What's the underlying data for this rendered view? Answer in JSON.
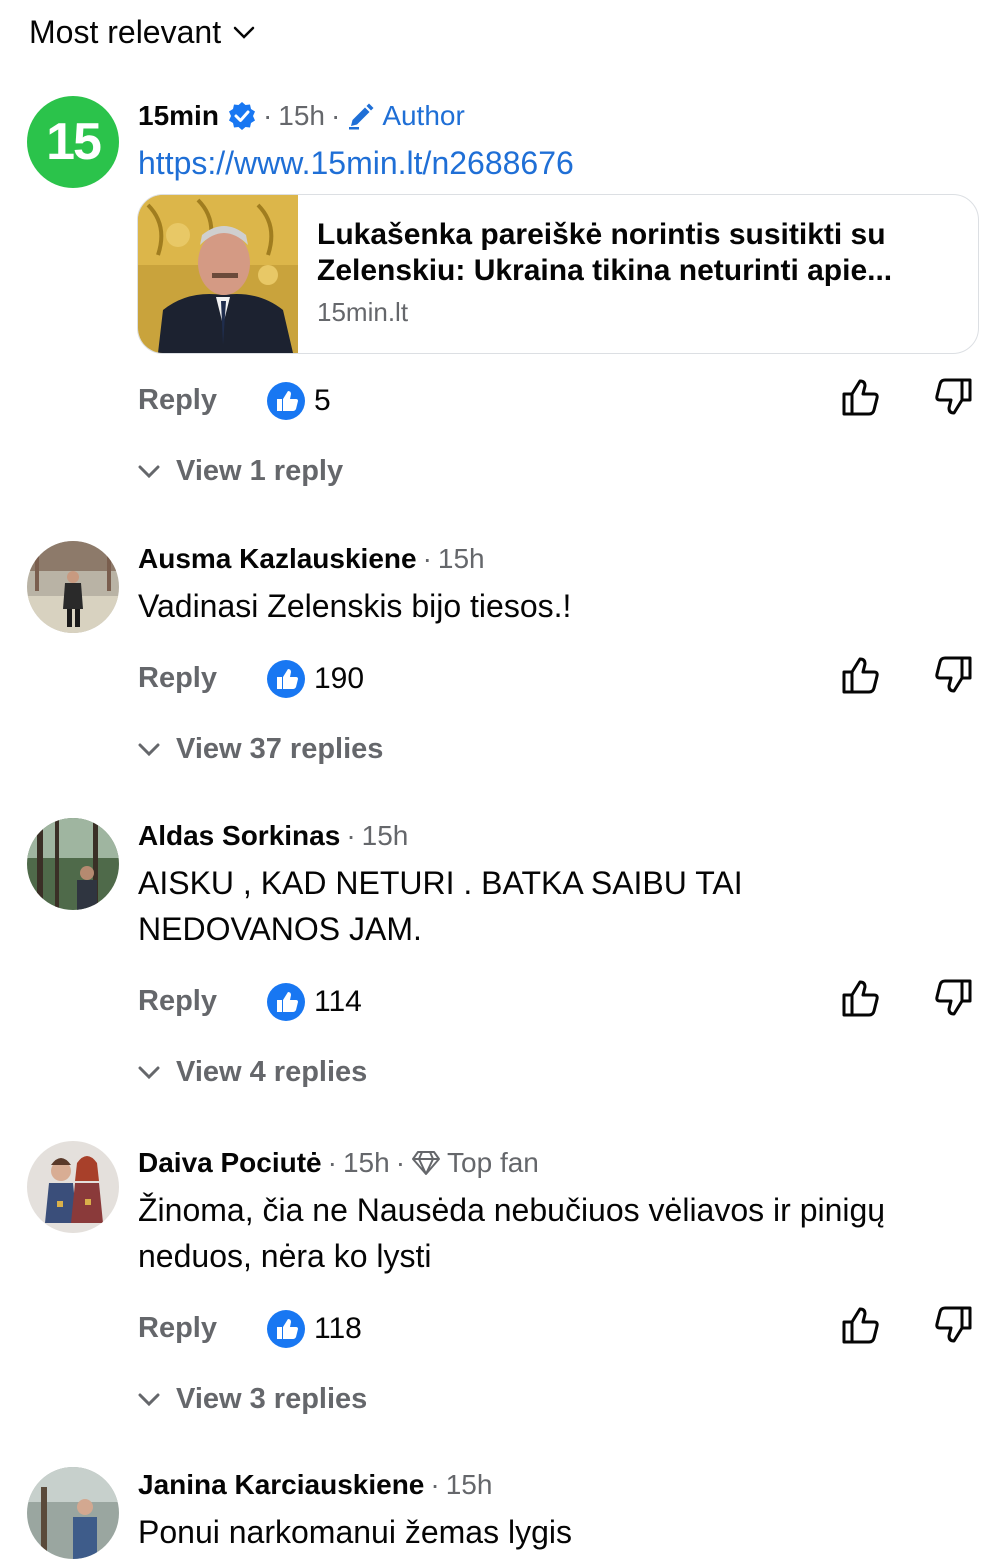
{
  "sort": {
    "label": "Most relevant"
  },
  "comments": [
    {
      "name": "15min",
      "avatar_text": "15",
      "verified": true,
      "time": "15h",
      "badge": "Author",
      "link_text": "https://www.15min.lt/n2688676",
      "card": {
        "title": "Lukašenka pareiškė norintis susitikti su Zelenskiu: Ukraina tikina neturinti apie...",
        "domain": "15min.lt"
      },
      "reply_label": "Reply",
      "reactions": "5",
      "view_replies": "View 1 reply"
    },
    {
      "name": "Ausma Kazlauskiene",
      "time": "15h",
      "text": "Vadinasi Zelenskis bijo tiesos.!",
      "reply_label": "Reply",
      "reactions": "190",
      "view_replies": "View 37 replies"
    },
    {
      "name": "Aldas Sorkinas",
      "time": "15h",
      "text": "AISKU , KAD NETURI . BATKA SAIBU  TAI NEDOVANOS  JAM.",
      "reply_label": "Reply",
      "reactions": "114",
      "view_replies": "View 4 replies"
    },
    {
      "name": "Daiva Pociutė",
      "time": "15h",
      "badge": "Top fan",
      "text": "Žinoma, čia ne Nausėda nebučiuos vėliavos ir pinigų neduos, nėra ko lysti",
      "reply_label": "Reply",
      "reactions": "118",
      "view_replies": "View 3 replies"
    },
    {
      "name": "Janina Karciauskiene",
      "time": "15h",
      "text": "Ponui narkomanui žemas lygis"
    }
  ],
  "colors": {
    "link": "#1f6fd6",
    "meta": "#65676b",
    "logo_green": "#2bc34b",
    "reaction_blue": "#1877f2"
  }
}
